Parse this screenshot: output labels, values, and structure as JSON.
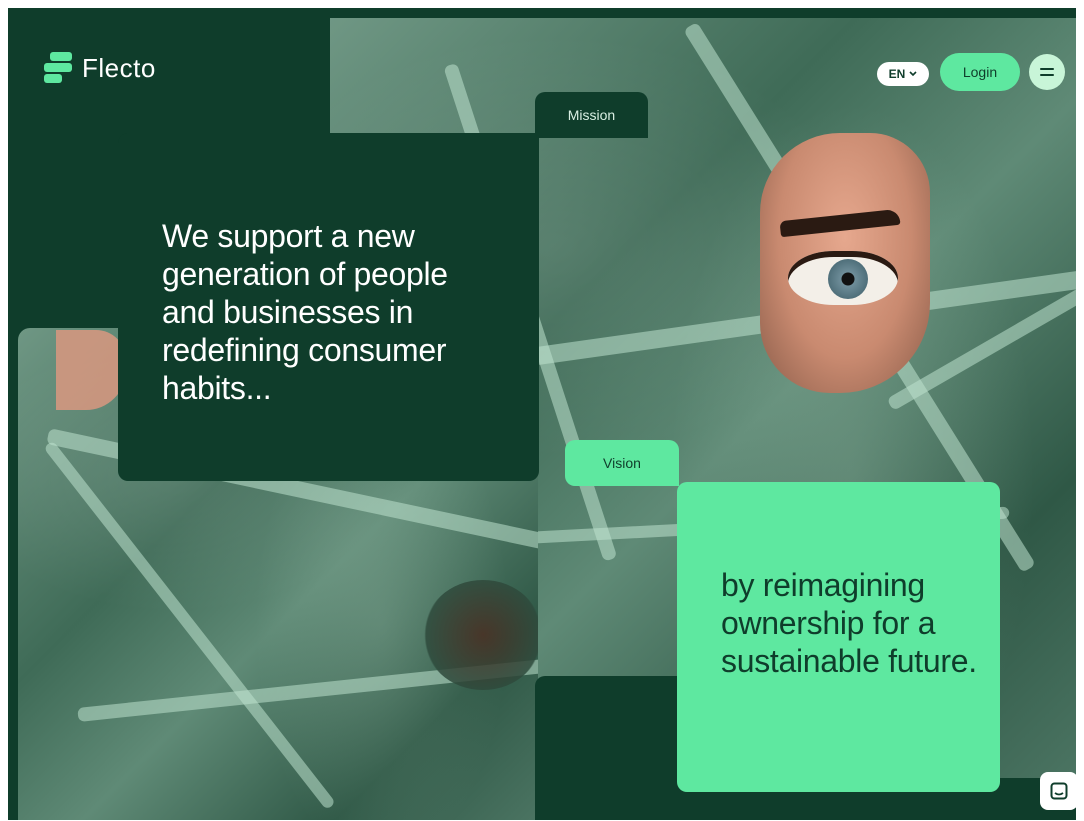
{
  "brand": {
    "name": "Flecto"
  },
  "header": {
    "language": "EN",
    "login_label": "Login"
  },
  "mission": {
    "tab_label": "Mission",
    "text": "We support a new generation of people and businesses in redefining consumer habits..."
  },
  "vision": {
    "tab_label": "Vision",
    "text": "by reimagining ownership for a sustainable future."
  },
  "colors": {
    "dark_green": "#0f3d2b",
    "accent_green": "#5ee8a0",
    "light_mint": "#c8f5d8"
  }
}
